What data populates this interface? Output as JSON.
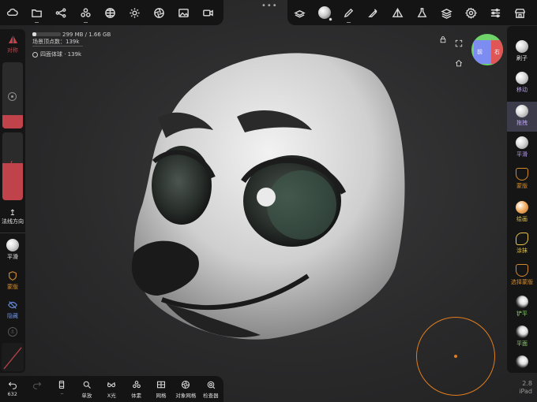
{
  "top_left_tools": [
    {
      "name": "cloud-icon"
    },
    {
      "name": "folder-icon"
    },
    {
      "name": "scene-graph-icon"
    },
    {
      "name": "mesh-tools-icon"
    },
    {
      "name": "topology-icon"
    },
    {
      "name": "light-icon"
    },
    {
      "name": "camera-aperture-icon"
    },
    {
      "name": "image-icon"
    },
    {
      "name": "video-icon"
    }
  ],
  "top_right_tools": [
    {
      "name": "layers-stack-icon"
    },
    {
      "name": "material-sphere-icon"
    },
    {
      "name": "brush-pen-icon"
    },
    {
      "name": "eyedropper-icon"
    },
    {
      "name": "symmetry-triangle-icon"
    },
    {
      "name": "flask-icon"
    },
    {
      "name": "layers-icon"
    },
    {
      "name": "settings-gear-icon"
    },
    {
      "name": "sliders-icon"
    },
    {
      "name": "shop-icon"
    }
  ],
  "info": {
    "memory": "299 MB / 1.66 GB",
    "scene_vertices": "场景顶点数：139k",
    "mesh_name": "四面体球 · 139k"
  },
  "left_sidebar": {
    "symmetry_label": "对称",
    "radius_fill": 0.2,
    "intensity_fill": 0.55,
    "normal_direction_label": "法线方向",
    "smooth_label": "平滑",
    "mask_label": "蒙版",
    "hide_label": "隐藏"
  },
  "right_sidebar": {
    "tools": [
      {
        "label": "刷子",
        "style": "ball"
      },
      {
        "label": "移动",
        "style": "ball"
      },
      {
        "label": "拖拽",
        "style": "ball"
      },
      {
        "label": "平滑",
        "style": "ball"
      },
      {
        "label": "蒙版",
        "style": "shield"
      },
      {
        "label": "绘画",
        "style": "orange"
      },
      {
        "label": "涂抹",
        "style": "smudge"
      },
      {
        "label": "选择蒙版",
        "style": "shield"
      },
      {
        "label": "铲平",
        "style": "dark"
      },
      {
        "label": "平面",
        "style": "dark"
      },
      {
        "label": "",
        "style": "dark"
      }
    ],
    "selected_index": 2
  },
  "orientation": {
    "front": "前",
    "right": "右"
  },
  "bottom_bar": {
    "undo_count": "632",
    "items": [
      {
        "label": "单放",
        "icon": "search-icon"
      },
      {
        "label": "X光",
        "icon": "glasses-icon"
      },
      {
        "label": "体素",
        "icon": "voxel-icon"
      },
      {
        "label": "网格",
        "icon": "grid-icon"
      },
      {
        "label": "对象网格",
        "icon": "object-mesh-icon"
      },
      {
        "label": "检查器",
        "icon": "inspector-icon"
      }
    ]
  },
  "version": {
    "number": "2.8",
    "device": "iPad"
  },
  "colors": {
    "accent_red": "#c0434b",
    "stroke_orange": "#e07d1e",
    "selected_bg": "#3b3b4a"
  }
}
